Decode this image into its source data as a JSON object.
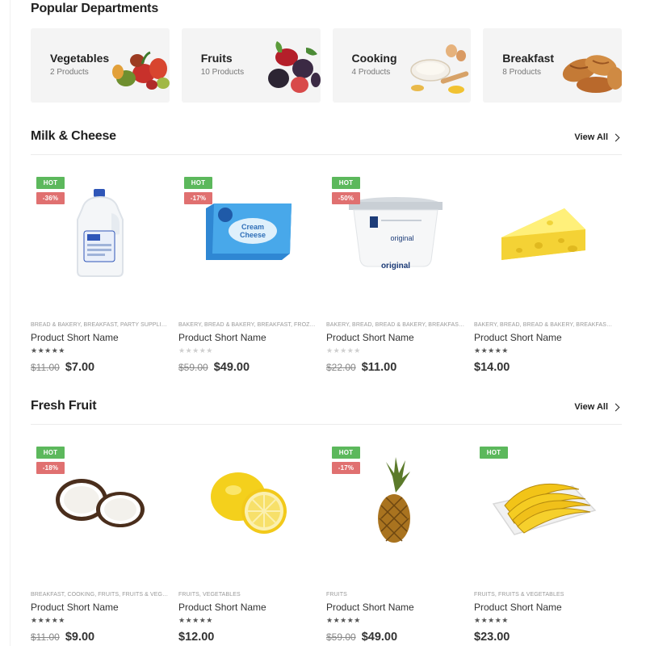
{
  "departments": {
    "title": "Popular Departments",
    "items": [
      {
        "name": "Vegetables",
        "count": "2 Products",
        "icon": "vegetables-icon"
      },
      {
        "name": "Fruits",
        "count": "10 Products",
        "icon": "fruits-icon"
      },
      {
        "name": "Cooking",
        "count": "4 Products",
        "icon": "cooking-icon"
      },
      {
        "name": "Breakfast",
        "count": "8 Products",
        "icon": "breakfast-icon"
      }
    ]
  },
  "milk_section": {
    "title": "Milk & Cheese",
    "view_all": "View All",
    "products": [
      {
        "image": "milk-jug-image",
        "hot": "HOT",
        "discount": "-36%",
        "categories": "BREAD & BAKERY, BREAKFAST, PARTY SUPPLIES & WINE",
        "name": "Product Short Name",
        "stars": "★★★★★",
        "rated": true,
        "old_price": "$11.00",
        "price": "$7.00"
      },
      {
        "image": "cream-cheese-image",
        "hot": "HOT",
        "discount": "-17%",
        "categories": "BAKERY, BREAD & BAKERY, BREAKFAST, FROZEN, FRUITS",
        "name": "Product Short Name",
        "stars": "★★★★★",
        "rated": false,
        "old_price": "$59.00",
        "price": "$49.00"
      },
      {
        "image": "yogurt-tub-image",
        "hot": "HOT",
        "discount": "-50%",
        "categories": "BAKERY, BREAD, BREAD & BAKERY, BREAKFAST, FRUITS",
        "name": "Product Short Name",
        "stars": "★★★★★",
        "rated": false,
        "old_price": "$22.00",
        "price": "$11.00"
      },
      {
        "image": "cheese-wedge-image",
        "hot": "",
        "discount": "",
        "categories": "BAKERY, BREAD, BREAD & BAKERY, BREAKFAST, PARTY",
        "name": "Product Short Name",
        "stars": "★★★★★",
        "rated": true,
        "old_price": "",
        "price": "$14.00"
      }
    ]
  },
  "fruit_section": {
    "title": "Fresh Fruit",
    "view_all": "View All",
    "products": [
      {
        "image": "coconut-image",
        "hot": "HOT",
        "discount": "-18%",
        "categories": "BREAKFAST, COOKING, FRUITS, FRUITS & VEGETABLES",
        "name": "Product Short Name",
        "stars": "★★★★★",
        "rated": true,
        "old_price": "$11.00",
        "price": "$9.00"
      },
      {
        "image": "lemon-image",
        "hot": "",
        "discount": "",
        "categories": "FRUITS, VEGETABLES",
        "name": "Product Short Name",
        "stars": "★★★★★",
        "rated": true,
        "old_price": "",
        "price": "$12.00"
      },
      {
        "image": "pineapple-image",
        "hot": "HOT",
        "discount": "-17%",
        "categories": "FRUITS",
        "name": "Product Short Name",
        "stars": "★★★★★",
        "rated": true,
        "old_price": "$59.00",
        "price": "$49.00"
      },
      {
        "image": "banana-image",
        "hot": "HOT",
        "discount": "",
        "categories": "FRUITS, FRUITS & VEGETABLES",
        "name": "Product Short Name",
        "stars": "★★★★★",
        "rated": true,
        "old_price": "",
        "price": "$23.00"
      }
    ]
  },
  "colors": {
    "hot_badge": "#5cb85c",
    "sale_badge": "#e07070",
    "card_bg": "#f4f4f4"
  }
}
